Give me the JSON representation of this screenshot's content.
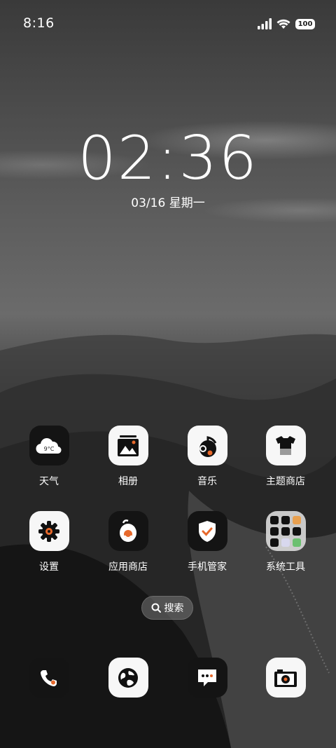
{
  "status_bar": {
    "time": "8:16",
    "battery": "100",
    "icons": [
      "signal-icon",
      "wifi-icon",
      "battery-icon"
    ]
  },
  "clock": {
    "time": "02:36",
    "date": "03/16 星期一"
  },
  "apps": [
    {
      "label": "天气",
      "icon": "weather-icon",
      "icon_text": "9°C"
    },
    {
      "label": "相册",
      "icon": "gallery-icon"
    },
    {
      "label": "音乐",
      "icon": "music-icon"
    },
    {
      "label": "主题商店",
      "icon": "theme-store-icon"
    },
    {
      "label": "设置",
      "icon": "settings-icon"
    },
    {
      "label": "应用商店",
      "icon": "app-store-icon"
    },
    {
      "label": "手机管家",
      "icon": "phone-manager-icon"
    },
    {
      "label": "系统工具",
      "icon": "system-tools-folder-icon"
    }
  ],
  "search": {
    "label": "搜索",
    "icon": "search-icon"
  },
  "dock": [
    {
      "icon": "phone-icon"
    },
    {
      "icon": "browser-icon"
    },
    {
      "icon": "messages-icon"
    },
    {
      "icon": "camera-icon"
    }
  ],
  "colors": {
    "accent": "#e8692b",
    "icon_light": "#f7f7f7",
    "icon_dark": "#141414"
  }
}
